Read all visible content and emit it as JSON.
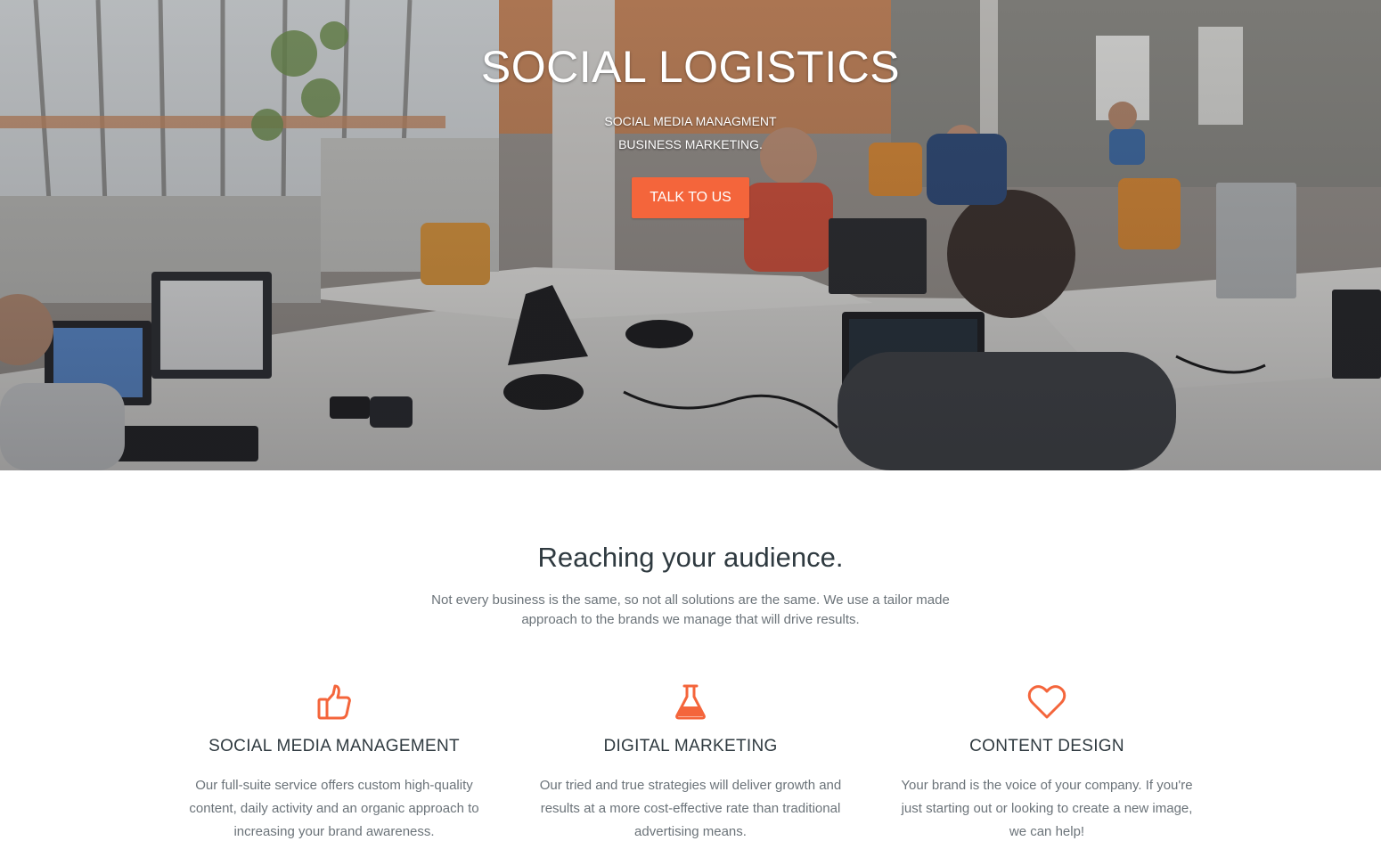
{
  "hero": {
    "title": "SOCIAL LOGISTICS",
    "subtitle_line1": "SOCIAL MEDIA MANAGMENT",
    "subtitle_line2": "BUSINESS MARKETING.",
    "cta_label": "TALK TO US"
  },
  "intro": {
    "title": "Reaching your audience.",
    "text": "Not every business is the same, so not all solutions are the same. We use a tailor made approach to the brands we manage that will drive results."
  },
  "features": [
    {
      "icon": "thumbs-up-icon",
      "title": "SOCIAL MEDIA MANAGEMENT",
      "text": "Our full-suite service offers custom high-quality content, daily activity and an organic approach to increasing your brand awareness."
    },
    {
      "icon": "flask-icon",
      "title": "DIGITAL MARKETING",
      "text": "Our tried and true strategies will deliver growth and results at a more cost-effective rate than traditional advertising means."
    },
    {
      "icon": "heart-icon",
      "title": "CONTENT DESIGN",
      "text": "Your brand is the voice of your company. If you're just starting out or looking to create a new image, we can help!"
    }
  ],
  "colors": {
    "accent": "#f4653b",
    "heading": "#2f3a40",
    "body_text": "#6b7379"
  }
}
